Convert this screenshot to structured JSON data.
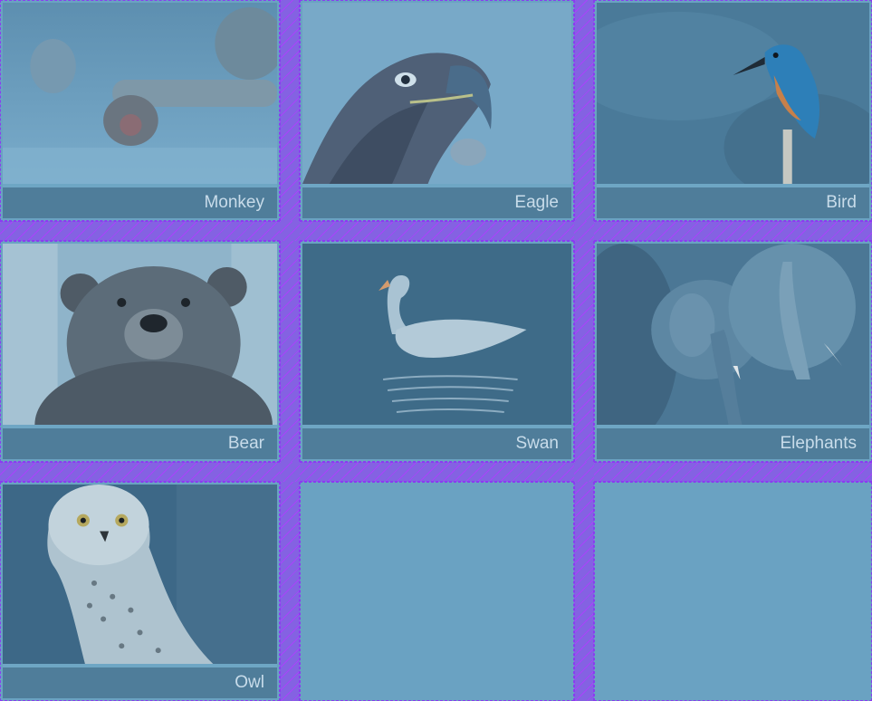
{
  "gallery": {
    "items": [
      {
        "label": "Monkey"
      },
      {
        "label": "Eagle"
      },
      {
        "label": "Bird"
      },
      {
        "label": "Bear"
      },
      {
        "label": "Swan"
      },
      {
        "label": "Elephants"
      },
      {
        "label": "Owl"
      }
    ]
  },
  "colors": {
    "page_background": "#6ba3c3",
    "caption_background": "#4f7d9a",
    "caption_text": "#c8dcea",
    "grid_gap_overlay": "#8c50eb"
  }
}
